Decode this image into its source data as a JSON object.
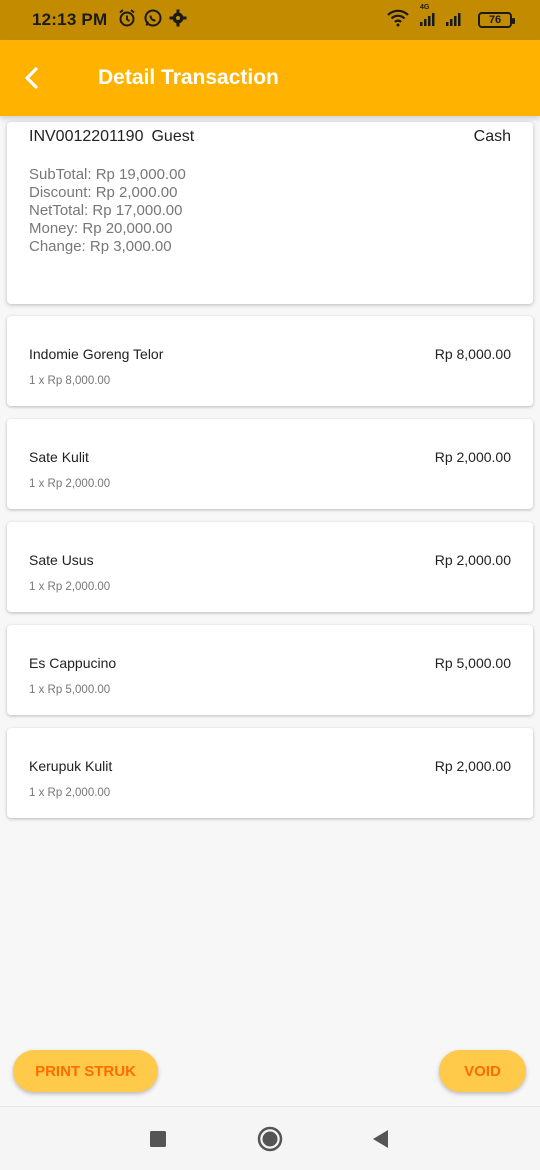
{
  "status": {
    "time": "12:13 PM",
    "network_label": "4G",
    "battery": "76"
  },
  "appbar": {
    "title": "Detail Transaction"
  },
  "summary": {
    "invoice": "INV0012201190",
    "customer": "Guest",
    "payment": "Cash",
    "subtotal": "SubTotal: Rp 19,000.00",
    "discount": "Discount: Rp 2,000.00",
    "nettotal": "NetTotal: Rp 17,000.00",
    "money": "Money: Rp 20,000.00",
    "change": "Change: Rp 3,000.00"
  },
  "items": [
    {
      "name": "Indomie Goreng Telor",
      "total": "Rp 8,000.00",
      "detail": "1 x Rp 8,000.00"
    },
    {
      "name": "Sate Kulit",
      "total": "Rp 2,000.00",
      "detail": "1 x Rp 2,000.00"
    },
    {
      "name": "Sate Usus",
      "total": "Rp 2,000.00",
      "detail": "1 x Rp 2,000.00"
    },
    {
      "name": "Es Cappucino",
      "total": "Rp 5,000.00",
      "detail": "1 x Rp 5,000.00"
    },
    {
      "name": "Kerupuk Kulit",
      "total": "Rp 2,000.00",
      "detail": "1 x Rp 2,000.00"
    }
  ],
  "buttons": {
    "print": "PRINT STRUK",
    "void": "VOID"
  },
  "colors": {
    "appbar": "#ffb300",
    "statusbar": "#c38c00",
    "button_bg": "#ffc94a",
    "button_text": "#ff6d00"
  },
  "icons": {
    "back": "back-arrow-icon",
    "alarm": "alarm-icon",
    "whatsapp": "whatsapp-icon",
    "settings": "gear-icon",
    "wifi": "wifi-icon",
    "signal": "signal-icon",
    "battery": "battery-icon",
    "nav_recent": "recent-apps-icon",
    "nav_home": "home-icon",
    "nav_back": "back-triangle-icon"
  }
}
